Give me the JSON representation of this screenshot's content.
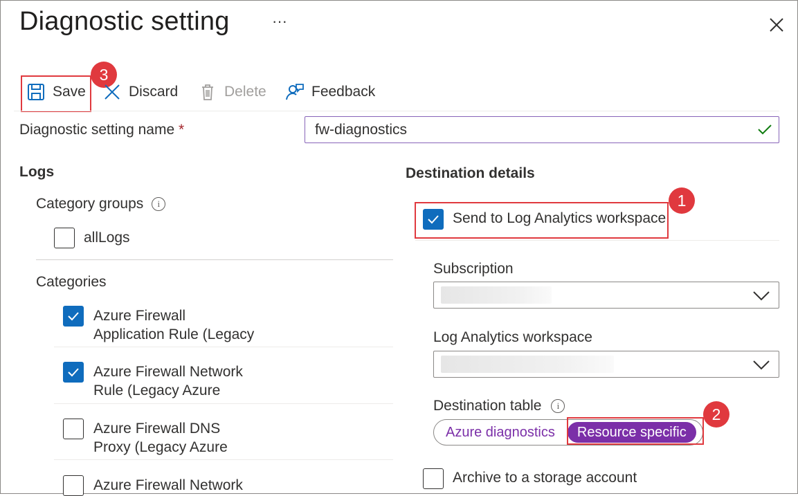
{
  "header": {
    "title": "Diagnostic setting",
    "more_glyph": "···"
  },
  "toolbar": {
    "save_label": "Save",
    "discard_label": "Discard",
    "delete_label": "Delete",
    "feedback_label": "Feedback"
  },
  "annotations": [
    "1",
    "2",
    "3"
  ],
  "setting_name": {
    "label": "Diagnostic setting name",
    "required_marker": "*",
    "value": "fw-diagnostics"
  },
  "logs": {
    "heading": "Logs",
    "category_groups_label": "Category groups",
    "category_groups": [
      {
        "label": "allLogs",
        "checked": false
      }
    ],
    "categories_label": "Categories",
    "categories": [
      {
        "line1": "Azure Firewall",
        "line2": "Application Rule (Legacy",
        "checked": true
      },
      {
        "line1": "Azure Firewall Network",
        "line2": "Rule (Legacy Azure",
        "checked": true
      },
      {
        "line1": "Azure Firewall DNS",
        "line2": "Proxy (Legacy Azure",
        "checked": false
      },
      {
        "line1": "Azure Firewall Network",
        "line2": "",
        "checked": false
      }
    ]
  },
  "destination": {
    "heading": "Destination details",
    "send_to_log_analytics": {
      "label": "Send to Log Analytics workspace",
      "checked": true
    },
    "subscription_label": "Subscription",
    "workspace_label": "Log Analytics workspace",
    "destination_table_label": "Destination table",
    "table_options": [
      "Azure diagnostics",
      "Resource specific"
    ],
    "table_selected": "Resource specific",
    "archive": {
      "label": "Archive to a storage account",
      "checked": false
    }
  },
  "colors": {
    "accent_purple": "#7b2fa8",
    "checkbox_blue": "#0f6cbd",
    "highlight_red": "#e0393e",
    "valid_green": "#107c10"
  }
}
